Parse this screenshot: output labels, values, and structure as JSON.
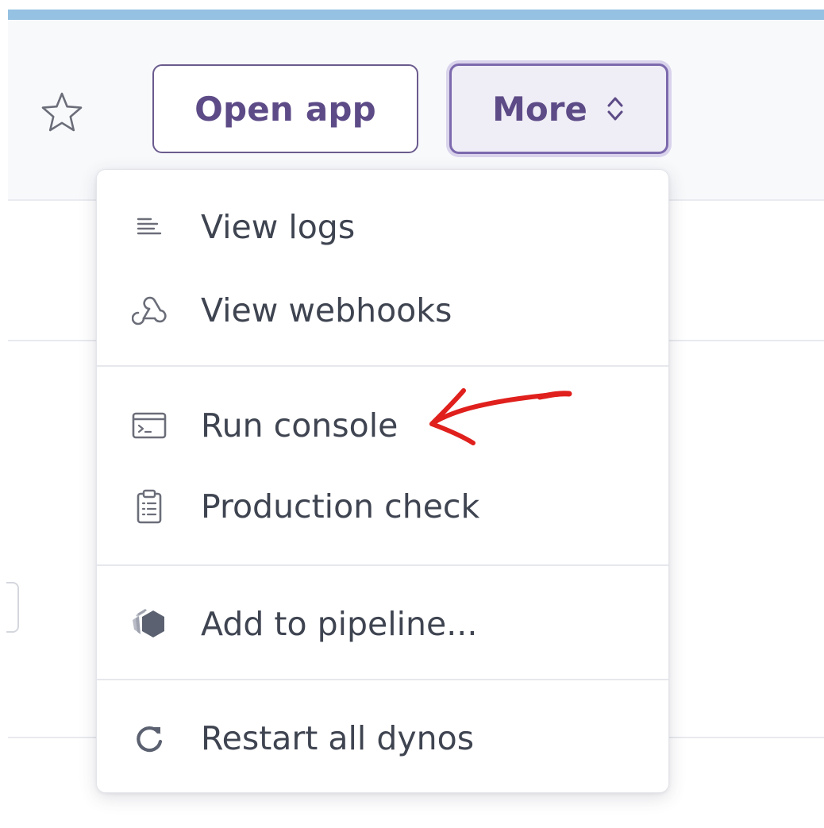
{
  "header": {
    "open_app_label": "Open app",
    "more_label": "More"
  },
  "menu": {
    "items": [
      {
        "label": "View logs",
        "icon": "logs-icon"
      },
      {
        "label": "View webhooks",
        "icon": "webhooks-icon"
      },
      {
        "label": "Run console",
        "icon": "console-icon"
      },
      {
        "label": "Production check",
        "icon": "clipboard-icon"
      },
      {
        "label": "Add to pipeline...",
        "icon": "pipeline-icon"
      },
      {
        "label": "Restart all dynos",
        "icon": "restart-icon"
      }
    ]
  },
  "colors": {
    "accent": "#5d4b87",
    "text": "#3f4451",
    "annotation": "#e0201d",
    "top_bar": "#95c1e2"
  }
}
